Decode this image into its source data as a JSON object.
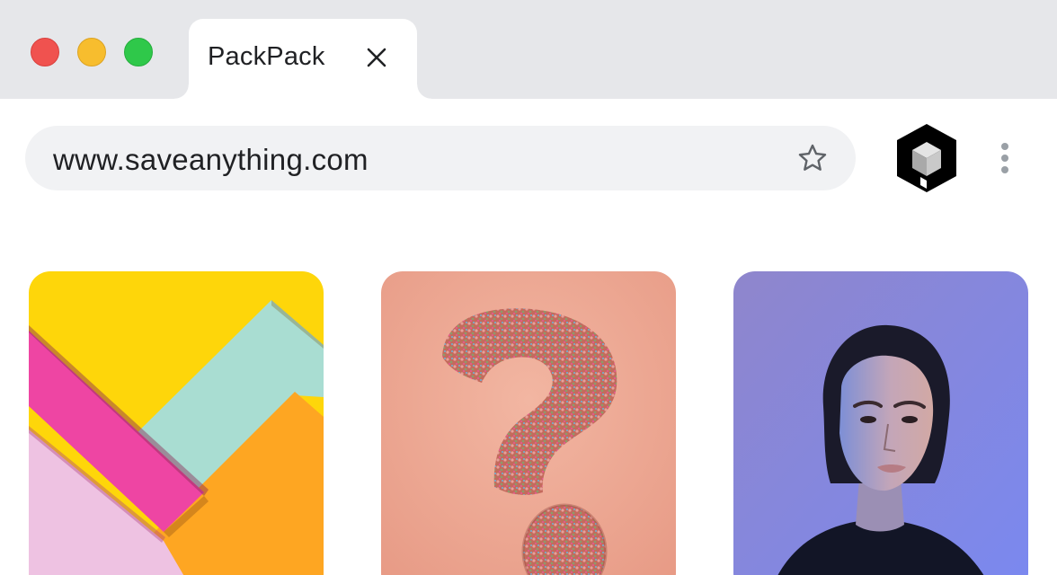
{
  "window": {
    "controls": [
      "close",
      "minimize",
      "maximize"
    ],
    "colors": {
      "close": "#f0524f",
      "minimize": "#f7bd2e",
      "maximize": "#2fc84a"
    }
  },
  "tab": {
    "title": "PackPack",
    "close_icon": "close-icon"
  },
  "address_bar": {
    "url": "www.saveanything.com",
    "bookmark_icon": "star-icon"
  },
  "toolbar": {
    "extension_icon": "packpack-logo-icon",
    "menu_icon": "more-vert-icon"
  },
  "gallery": {
    "items": [
      {
        "image": "colorful-geometric-paper-shapes"
      },
      {
        "image": "knitted-question-mark-sculpture"
      },
      {
        "image": "portrait-woman-blue-light"
      }
    ]
  },
  "colors": {
    "titlebar": "#e6e7ea",
    "addressbar": "#f1f2f4",
    "text": "#202124"
  }
}
